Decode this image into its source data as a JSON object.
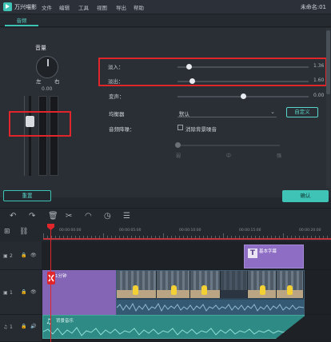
{
  "app": {
    "name": "万兴喵影",
    "menus": [
      "文件",
      "编辑",
      "工具",
      "视图",
      "导出",
      "帮助"
    ],
    "doc_title": "未命名:01"
  },
  "tabs": [
    {
      "label": "音频"
    }
  ],
  "left_panel": {
    "volume_label": "音量",
    "pan_left": "左",
    "pan_right": "右",
    "pan_value": "0.00",
    "volume_level": 0.68
  },
  "adjust": {
    "fade_in_label": "淡入：",
    "fade_in_value": "1.36",
    "fade_in_fraction": 0.09,
    "fade_out_label": "淡出：",
    "fade_out_value": "1.60",
    "fade_out_fraction": 0.11,
    "pitch_label": "变声：",
    "pitch_value": "0.00",
    "pitch_fraction": 0.5,
    "eq_label": "均衡器",
    "eq_value": "默认",
    "custom_label": "自定义",
    "denoise_title": "音频降噪：",
    "denoise_label": "消除背景噪音",
    "denoise_low": "弱",
    "denoise_mid": "中",
    "denoise_high": "强"
  },
  "buttons": {
    "reset": "重置",
    "ok": "确认"
  },
  "timeline": {
    "ruler_labels": [
      "00:00:00:00",
      "00:00:05:00",
      "00:00:10:00",
      "00:00:15:00",
      "00:00:20:00"
    ],
    "tracks": [
      {
        "number": "2",
        "clip_label": "基本字幕"
      },
      {
        "number": "1",
        "clip_label": "1分钟"
      },
      {
        "number": "1",
        "clip_label": "背景音乐"
      }
    ]
  },
  "colors": {
    "accent": "#3fc3b7",
    "highlight": "#e0262a",
    "title_clip": "#8d6ec4",
    "audio_clip": "#2e8a84"
  }
}
